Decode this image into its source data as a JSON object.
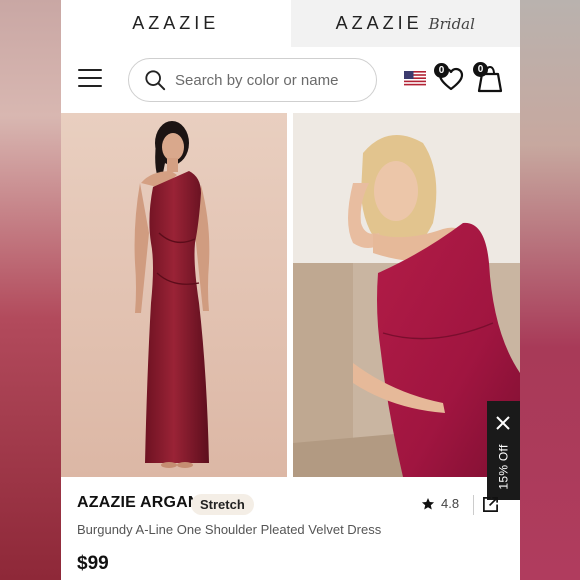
{
  "brand_tabs": {
    "main_label": "AZAZIE",
    "bridal_label": "AZAZIE",
    "bridal_script": "Bridal"
  },
  "header": {
    "search_placeholder": "Search by color or name",
    "wishlist_count": "0",
    "cart_count": "0",
    "region_flag": "us-flag-icon"
  },
  "images": [
    {
      "alt": "Model in burgundy one shoulder velvet dress, front view",
      "dress_color": "#8a1a2c"
    },
    {
      "alt": "Model in burgundy one shoulder velvet dress, seated",
      "dress_color": "#a4173f"
    }
  ],
  "product": {
    "brand": "AZAZIE ARGAN",
    "tag": "Stretch",
    "rating": "4.8",
    "description": "Burgundy A-Line One Shoulder Pleated Velvet Dress",
    "price": "$99"
  },
  "promo": {
    "label": "15% Off"
  },
  "colors": {
    "text_primary": "#111111",
    "tag_background": "#f4eee6",
    "promo_background": "#1a1a1a",
    "dress_burgundy": "#8a1a2c"
  }
}
